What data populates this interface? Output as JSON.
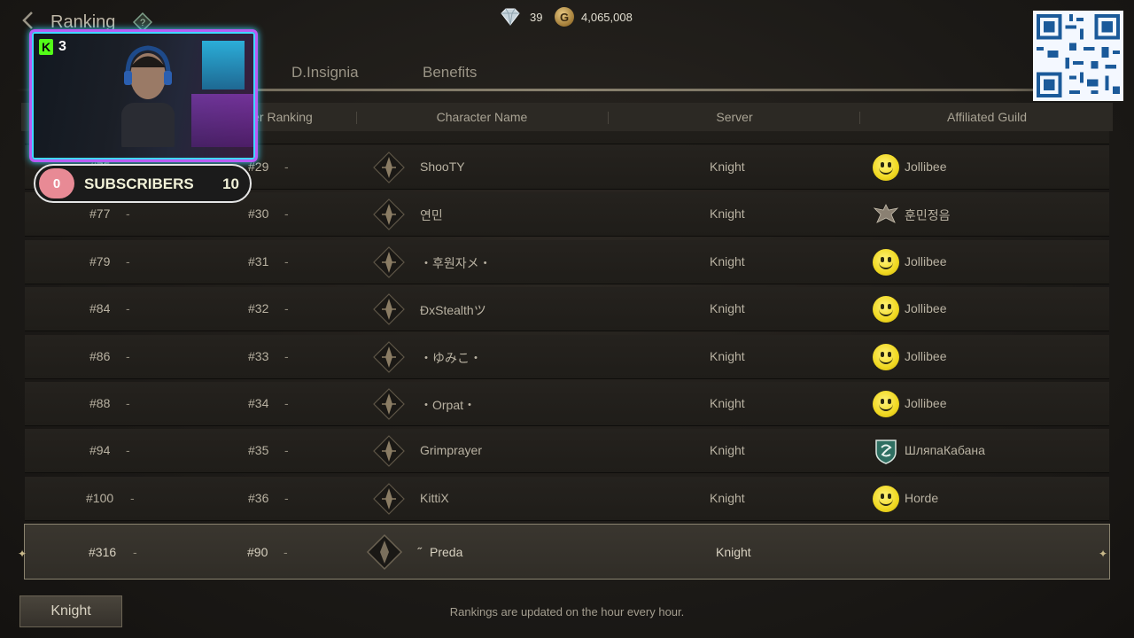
{
  "header": {
    "title": "Ranking",
    "gems": "39",
    "gold": "4,065,008",
    "gold_symbol": "G"
  },
  "tabs": [
    {
      "label": "D.Insignia"
    },
    {
      "label": "Benefits"
    }
  ],
  "columns": {
    "class_ranking": "er Ranking",
    "character_name": "Character Name",
    "server": "Server",
    "guild": "Affiliated Guild"
  },
  "rows": [
    {
      "overall": "#75",
      "change1": "-",
      "class_rank": "#29",
      "change2": "-",
      "name": "ShooTY",
      "server": "Knight",
      "guild": "Jollibee",
      "emblem": "smiley-emblem"
    },
    {
      "overall": "#77",
      "change1": "-",
      "class_rank": "#30",
      "change2": "-",
      "name": "연민",
      "server": "Knight",
      "guild": "훈민정음",
      "emblem": "eagle-emblem"
    },
    {
      "overall": "#79",
      "change1": "-",
      "class_rank": "#31",
      "change2": "-",
      "name": "・후원자メ・",
      "server": "Knight",
      "guild": "Jollibee",
      "emblem": "smiley-emblem"
    },
    {
      "overall": "#84",
      "change1": "-",
      "class_rank": "#32",
      "change2": "-",
      "name": "ÐxStealthツ",
      "server": "Knight",
      "guild": "Jollibee",
      "emblem": "smiley-emblem"
    },
    {
      "overall": "#86",
      "change1": "-",
      "class_rank": "#33",
      "change2": "-",
      "name": "・ゆみこ・",
      "server": "Knight",
      "guild": "Jollibee",
      "emblem": "smiley-emblem"
    },
    {
      "overall": "#88",
      "change1": "-",
      "class_rank": "#34",
      "change2": "-",
      "name": "・Orpat・",
      "server": "Knight",
      "guild": "Jollibee",
      "emblem": "smiley-emblem"
    },
    {
      "overall": "#94",
      "change1": "-",
      "class_rank": "#35",
      "change2": "-",
      "name": "Grimprayer",
      "server": "Knight",
      "guild": "ШляпаКабана",
      "emblem": "shield-emblem"
    },
    {
      "overall": "#100",
      "change1": "-",
      "class_rank": "#36",
      "change2": "-",
      "name": "KittiX",
      "server": "Knight",
      "guild": "Horde",
      "emblem": "smiley-emblem"
    }
  ],
  "my_row": {
    "overall": "#316",
    "change1": "-",
    "class_rank": "#90",
    "change2": "-",
    "name_prefix": "˝",
    "name": "Preda",
    "server": "Knight"
  },
  "footer": {
    "server_button": "Knight",
    "note": "Rankings are updated on the hour every hour."
  },
  "overlay": {
    "kick_logo": "K",
    "viewer_count": "3",
    "sub_current": "0",
    "sub_label": "SUBSCRIBERS",
    "sub_target": "10"
  },
  "colors": {
    "accent_gold": "#c9b98a",
    "webcam_border": "#b85cf5",
    "kick_green": "#53fc18"
  }
}
